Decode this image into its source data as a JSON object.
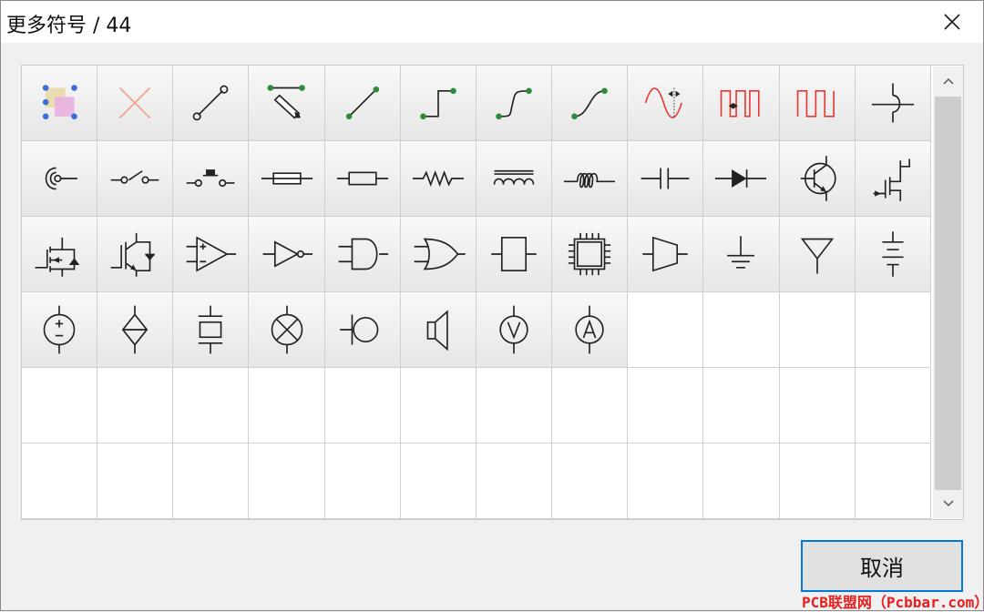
{
  "window": {
    "title": "更多符号 / 44",
    "close_icon": "close-icon"
  },
  "grid": {
    "columns": 12,
    "rows": 6,
    "symbols": [
      "align-shapes-icon",
      "delete-x-icon",
      "line-open-ends-icon",
      "pen-draw-line-icon",
      "line-dot-ends-icon",
      "step-connector-icon",
      "s-curve-connector-icon",
      "smooth-curve-connector-icon",
      "sine-wave-icon",
      "pulse-wave-icon",
      "square-wave-icon",
      "wire-jumper-icon",
      "coaxial-icon",
      "switch-icon",
      "push-button-icon",
      "fuse-icon",
      "resistor-box-icon",
      "resistor-zigzag-icon",
      "inductor-core-icon",
      "inductor-coil-icon",
      "capacitor-icon",
      "diode-icon",
      "npn-transistor-icon",
      "jfet-icon",
      "mosfet-icon",
      "igbt-icon",
      "op-amp-icon",
      "not-gate-icon",
      "and-gate-icon",
      "or-gate-icon",
      "ic-block-icon",
      "chip-icon",
      "mux-icon",
      "ground-icon",
      "antenna-icon",
      "battery-icon",
      "voltage-source-icon",
      "current-source-icon",
      "crystal-icon",
      "lamp-icon",
      "microphone-icon",
      "speaker-icon",
      "voltmeter-icon",
      "ammeter-icon"
    ]
  },
  "scrollbar": {
    "up_icon": "chevron-up-icon",
    "down_icon": "chevron-down-icon"
  },
  "buttons": {
    "cancel_label": "取消"
  },
  "watermark": "PCB联盟网（Pcbbar.com）",
  "colors": {
    "accent": "#0078d7",
    "symbol_stroke": "#222222",
    "handle_green": "#2e8b3a",
    "wave_red": "#e53935",
    "select_blue": "#3a6fd8"
  }
}
